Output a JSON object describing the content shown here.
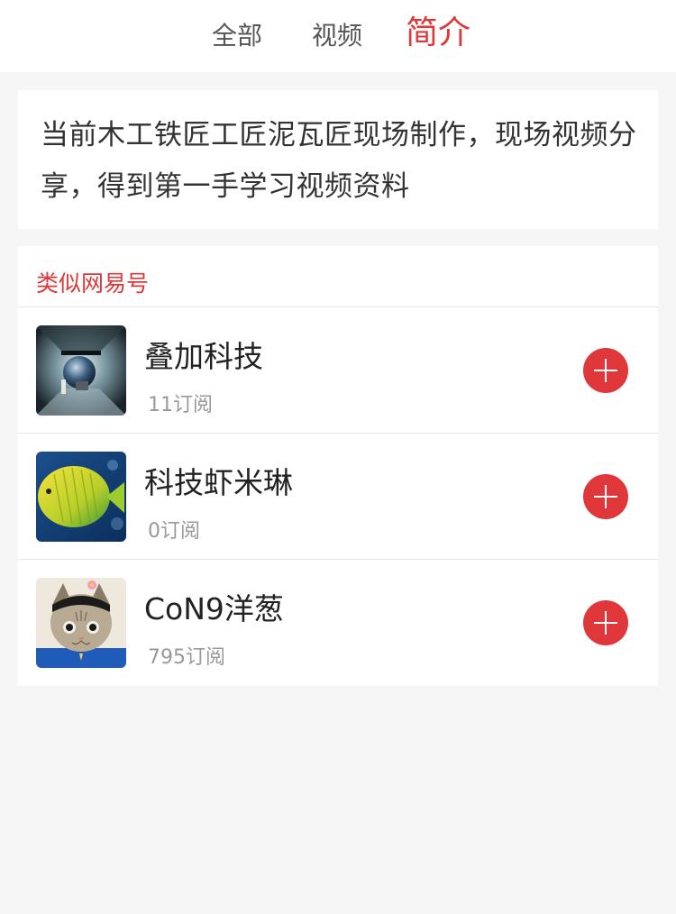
{
  "tabs": {
    "all": "全部",
    "video": "视频",
    "intro": "简介",
    "active": "简介"
  },
  "intro": {
    "text": "当前木工铁匠工匠泥瓦匠现场制作，现场视频分享，得到第一手学习视频资料"
  },
  "similar": {
    "title": "类似网易号",
    "accent_color": "#e0383a",
    "items": [
      {
        "name": "叠加科技",
        "subscribers": "11订阅",
        "avatar": "space-scene-avatar"
      },
      {
        "name": "科技虾米琳",
        "subscribers": "0订阅",
        "avatar": "yellow-fish-avatar"
      },
      {
        "name": "CoN9洋葱",
        "subscribers": "795订阅",
        "avatar": "cat-avatar"
      }
    ]
  }
}
